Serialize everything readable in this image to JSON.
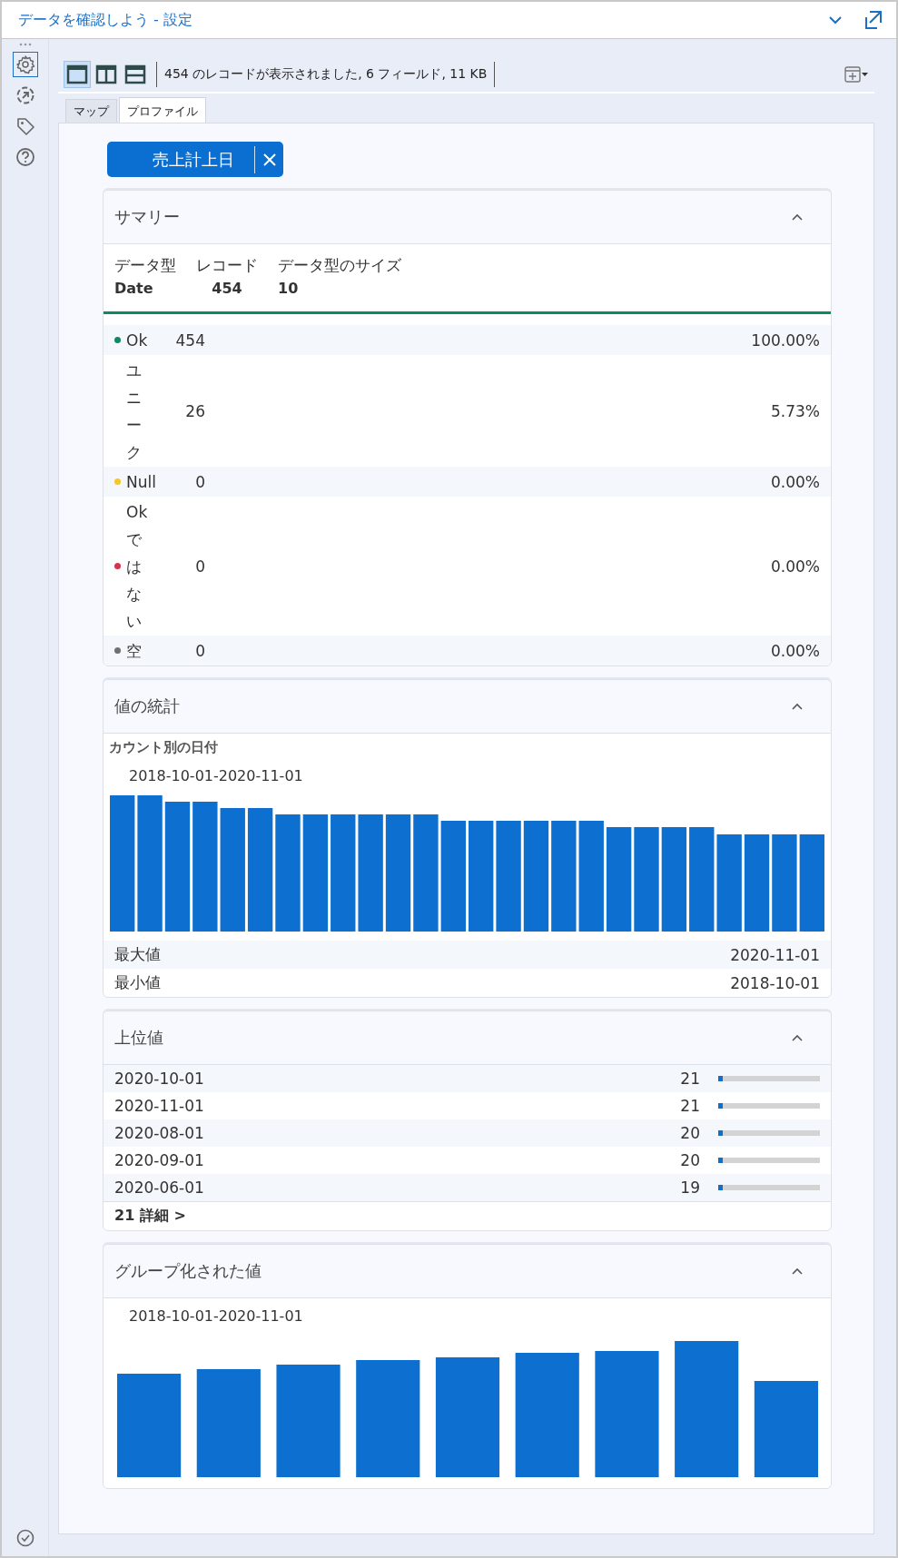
{
  "window": {
    "title": "データを確認しよう - 設定"
  },
  "sidebar": {
    "items": [
      {
        "selected": true
      },
      {
        "selected": false
      },
      {
        "selected": false
      },
      {
        "selected": false
      }
    ]
  },
  "toolbar": {
    "layouts": [
      {
        "selected": true
      },
      {
        "selected": false
      },
      {
        "selected": false
      }
    ],
    "status": "454 のレコードが表示されました, 6 フィールド, 11 KB"
  },
  "tabs": [
    {
      "label": "マップ",
      "selected": false
    },
    {
      "label": "プロファイル",
      "selected": true
    }
  ],
  "field": {
    "name": "売上計上日"
  },
  "summary": {
    "title": "サマリー",
    "fields": [
      {
        "label": "データ型",
        "value": "Date"
      },
      {
        "label": "レコード",
        "value": "454"
      },
      {
        "label": "データ型のサイズ",
        "value": "10"
      }
    ],
    "statuses": [
      {
        "label": "Ok",
        "count": "454",
        "percent": "100.00%",
        "color": "#0b8a63"
      },
      {
        "label": "ユニーク",
        "count": "26",
        "percent": "5.73%"
      },
      {
        "label": "Null",
        "count": "0",
        "percent": "0.00%",
        "color": "#f6c623"
      },
      {
        "label": "Okではない",
        "count": "0",
        "percent": "0.00%",
        "color": "#d8324f"
      },
      {
        "label": "空",
        "count": "0",
        "percent": "0.00%",
        "color": "#707070"
      }
    ]
  },
  "value_stats": {
    "title": "値の統計",
    "chart_title": "カウント別の日付",
    "range": "2018-10-01-2020-11-01",
    "rows": [
      {
        "label": "最大値",
        "value": "2020-11-01"
      },
      {
        "label": "最小値",
        "value": "2018-10-01"
      }
    ]
  },
  "top_values": {
    "title": "上位値",
    "rows": [
      {
        "value": "2020-10-01",
        "count": "21",
        "level": 0.046
      },
      {
        "value": "2020-11-01",
        "count": "21",
        "level": 0.046
      },
      {
        "value": "2020-08-01",
        "count": "20",
        "level": 0.044
      },
      {
        "value": "2020-09-01",
        "count": "20",
        "level": 0.044
      },
      {
        "value": "2020-06-01",
        "count": "19",
        "level": 0.042
      }
    ],
    "more": "21 詳細 >"
  },
  "grouped": {
    "title": "グループ化された値",
    "range": "2018-10-01-2020-11-01"
  }
}
